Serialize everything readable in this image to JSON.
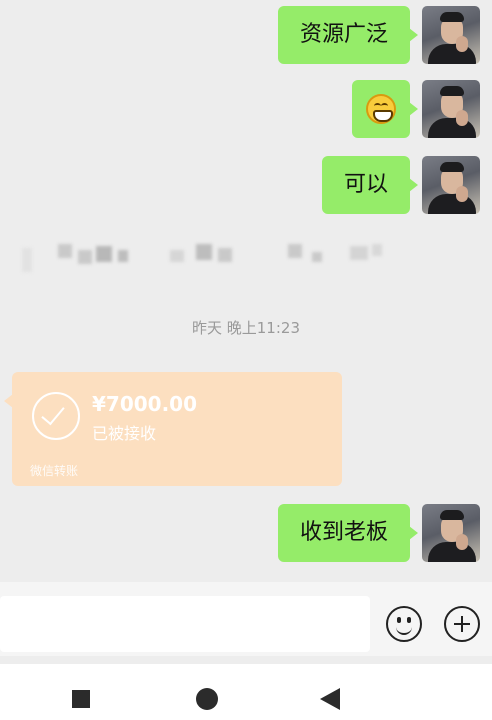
{
  "messages": [
    {
      "text": "资源广泛"
    },
    {
      "emoji": "grinning-face"
    },
    {
      "text": "可以"
    },
    {
      "text": "收到老板"
    }
  ],
  "timestamp": "昨天 晚上11:23",
  "transfer": {
    "amount": "¥7000.00",
    "status": "已被接收",
    "source": "微信转账"
  },
  "colors": {
    "bubble": "#95ec69",
    "transfer": "#fcdfc0",
    "background": "#ededed"
  }
}
